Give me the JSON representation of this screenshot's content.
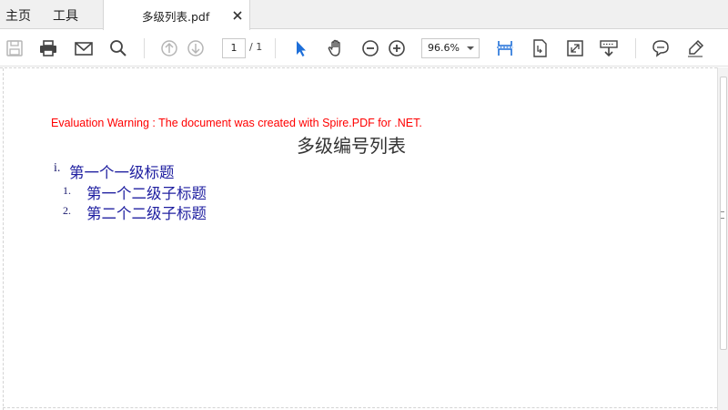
{
  "menu": {
    "home_label": "主页",
    "tools_label": "工具"
  },
  "tab": {
    "title": "多级列表.pdf"
  },
  "toolbar": {
    "page_current": "1",
    "page_total": "/ 1",
    "zoom_value": "96.6%"
  },
  "document": {
    "eval_warning": "Evaluation Warning : The document was created with Spire.PDF for .NET.",
    "title": "多级编号列表",
    "list": {
      "level1": {
        "marker": "i.",
        "text": "第一个一级标题"
      },
      "level2": [
        {
          "marker": "1.",
          "text": "第一个二级子标题"
        },
        {
          "marker": "2.",
          "text": "第二个二级子标题"
        }
      ]
    }
  },
  "colors": {
    "eval_warning": "#ff0000",
    "list_text": "#1f1fa0",
    "accent_blue": "#1e6fd9"
  }
}
